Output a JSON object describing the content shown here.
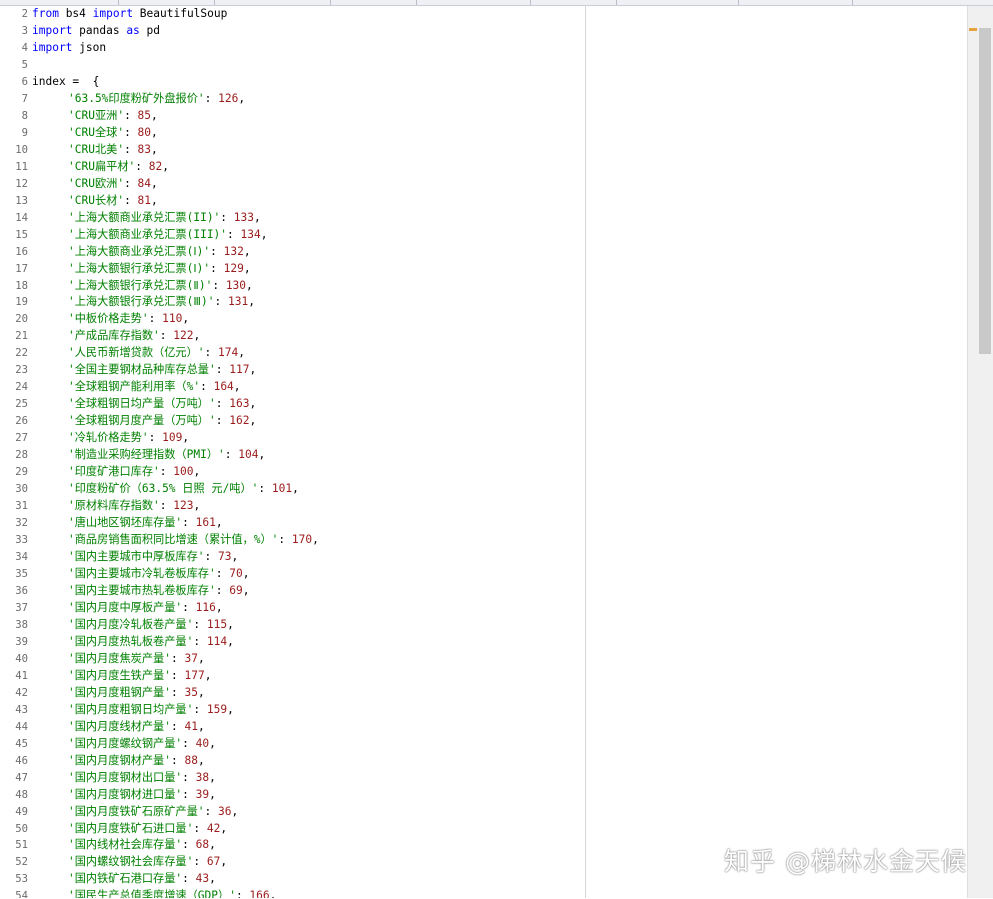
{
  "editor": {
    "lines": [
      {
        "n": "2",
        "segs": [
          {
            "c": "kw",
            "t": "from "
          },
          {
            "c": "pl",
            "t": "bs4 "
          },
          {
            "c": "kw",
            "t": "import "
          },
          {
            "c": "pl",
            "t": "BeautifulSoup"
          }
        ]
      },
      {
        "n": "3",
        "segs": [
          {
            "c": "kw",
            "t": "import "
          },
          {
            "c": "pl",
            "t": "pandas "
          },
          {
            "c": "kw",
            "t": "as "
          },
          {
            "c": "pl",
            "t": "pd"
          }
        ]
      },
      {
        "n": "4",
        "segs": [
          {
            "c": "kw",
            "t": "import "
          },
          {
            "c": "pl",
            "t": "json"
          }
        ]
      },
      {
        "n": "5",
        "segs": []
      },
      {
        "n": "6",
        "segs": [
          {
            "c": "pl",
            "t": "index =  {"
          }
        ]
      },
      {
        "n": "7",
        "ind": true,
        "segs": [
          {
            "c": "st",
            "t": "'63.5%印度粉矿外盘报价'"
          },
          {
            "c": "pl",
            "t": ": "
          },
          {
            "c": "nm",
            "t": "126"
          },
          {
            "c": "pl",
            "t": ","
          }
        ]
      },
      {
        "n": "8",
        "ind": true,
        "segs": [
          {
            "c": "st",
            "t": "'CRU亚洲'"
          },
          {
            "c": "pl",
            "t": ": "
          },
          {
            "c": "nm",
            "t": "85"
          },
          {
            "c": "pl",
            "t": ","
          }
        ]
      },
      {
        "n": "9",
        "ind": true,
        "segs": [
          {
            "c": "st",
            "t": "'CRU全球'"
          },
          {
            "c": "pl",
            "t": ": "
          },
          {
            "c": "nm",
            "t": "80"
          },
          {
            "c": "pl",
            "t": ","
          }
        ]
      },
      {
        "n": "10",
        "ind": true,
        "segs": [
          {
            "c": "st",
            "t": "'CRU北美'"
          },
          {
            "c": "pl",
            "t": ": "
          },
          {
            "c": "nm",
            "t": "83"
          },
          {
            "c": "pl",
            "t": ","
          }
        ]
      },
      {
        "n": "11",
        "ind": true,
        "segs": [
          {
            "c": "st",
            "t": "'CRU扁平材'"
          },
          {
            "c": "pl",
            "t": ": "
          },
          {
            "c": "nm",
            "t": "82"
          },
          {
            "c": "pl",
            "t": ","
          }
        ]
      },
      {
        "n": "12",
        "ind": true,
        "segs": [
          {
            "c": "st",
            "t": "'CRU欧洲'"
          },
          {
            "c": "pl",
            "t": ": "
          },
          {
            "c": "nm",
            "t": "84"
          },
          {
            "c": "pl",
            "t": ","
          }
        ]
      },
      {
        "n": "13",
        "ind": true,
        "segs": [
          {
            "c": "st",
            "t": "'CRU长材'"
          },
          {
            "c": "pl",
            "t": ": "
          },
          {
            "c": "nm",
            "t": "81"
          },
          {
            "c": "pl",
            "t": ","
          }
        ]
      },
      {
        "n": "14",
        "ind": true,
        "segs": [
          {
            "c": "st",
            "t": "'上海大额商业承兑汇票(II)'"
          },
          {
            "c": "pl",
            "t": ": "
          },
          {
            "c": "nm",
            "t": "133"
          },
          {
            "c": "pl",
            "t": ","
          }
        ]
      },
      {
        "n": "15",
        "ind": true,
        "segs": [
          {
            "c": "st",
            "t": "'上海大额商业承兑汇票(III)'"
          },
          {
            "c": "pl",
            "t": ": "
          },
          {
            "c": "nm",
            "t": "134"
          },
          {
            "c": "pl",
            "t": ","
          }
        ]
      },
      {
        "n": "16",
        "ind": true,
        "segs": [
          {
            "c": "st",
            "t": "'上海大额商业承兑汇票(Ⅰ)'"
          },
          {
            "c": "pl",
            "t": ": "
          },
          {
            "c": "nm",
            "t": "132"
          },
          {
            "c": "pl",
            "t": ","
          }
        ]
      },
      {
        "n": "17",
        "ind": true,
        "segs": [
          {
            "c": "st",
            "t": "'上海大额银行承兑汇票(Ⅰ)'"
          },
          {
            "c": "pl",
            "t": ": "
          },
          {
            "c": "nm",
            "t": "129"
          },
          {
            "c": "pl",
            "t": ","
          }
        ]
      },
      {
        "n": "18",
        "ind": true,
        "segs": [
          {
            "c": "st",
            "t": "'上海大额银行承兑汇票(Ⅱ)'"
          },
          {
            "c": "pl",
            "t": ": "
          },
          {
            "c": "nm",
            "t": "130"
          },
          {
            "c": "pl",
            "t": ","
          }
        ]
      },
      {
        "n": "19",
        "ind": true,
        "segs": [
          {
            "c": "st",
            "t": "'上海大额银行承兑汇票(Ⅲ)'"
          },
          {
            "c": "pl",
            "t": ": "
          },
          {
            "c": "nm",
            "t": "131"
          },
          {
            "c": "pl",
            "t": ","
          }
        ]
      },
      {
        "n": "20",
        "ind": true,
        "segs": [
          {
            "c": "st",
            "t": "'中板价格走势'"
          },
          {
            "c": "pl",
            "t": ": "
          },
          {
            "c": "nm",
            "t": "110"
          },
          {
            "c": "pl",
            "t": ","
          }
        ]
      },
      {
        "n": "21",
        "ind": true,
        "segs": [
          {
            "c": "st",
            "t": "'产成品库存指数'"
          },
          {
            "c": "pl",
            "t": ": "
          },
          {
            "c": "nm",
            "t": "122"
          },
          {
            "c": "pl",
            "t": ","
          }
        ]
      },
      {
        "n": "22",
        "ind": true,
        "segs": [
          {
            "c": "st",
            "t": "'人民币新增贷款（亿元）'"
          },
          {
            "c": "pl",
            "t": ": "
          },
          {
            "c": "nm",
            "t": "174"
          },
          {
            "c": "pl",
            "t": ","
          }
        ]
      },
      {
        "n": "23",
        "ind": true,
        "segs": [
          {
            "c": "st",
            "t": "'全国主要钢材品种库存总量'"
          },
          {
            "c": "pl",
            "t": ": "
          },
          {
            "c": "nm",
            "t": "117"
          },
          {
            "c": "pl",
            "t": ","
          }
        ]
      },
      {
        "n": "24",
        "ind": true,
        "segs": [
          {
            "c": "st",
            "t": "'全球粗钢产能利用率（%'"
          },
          {
            "c": "pl",
            "t": ": "
          },
          {
            "c": "nm",
            "t": "164"
          },
          {
            "c": "pl",
            "t": ","
          }
        ]
      },
      {
        "n": "25",
        "ind": true,
        "segs": [
          {
            "c": "st",
            "t": "'全球粗钢日均产量（万吨）'"
          },
          {
            "c": "pl",
            "t": ": "
          },
          {
            "c": "nm",
            "t": "163"
          },
          {
            "c": "pl",
            "t": ","
          }
        ]
      },
      {
        "n": "26",
        "ind": true,
        "segs": [
          {
            "c": "st",
            "t": "'全球粗钢月度产量（万吨）'"
          },
          {
            "c": "pl",
            "t": ": "
          },
          {
            "c": "nm",
            "t": "162"
          },
          {
            "c": "pl",
            "t": ","
          }
        ]
      },
      {
        "n": "27",
        "ind": true,
        "segs": [
          {
            "c": "st",
            "t": "'冷轧价格走势'"
          },
          {
            "c": "pl",
            "t": ": "
          },
          {
            "c": "nm",
            "t": "109"
          },
          {
            "c": "pl",
            "t": ","
          }
        ]
      },
      {
        "n": "28",
        "ind": true,
        "segs": [
          {
            "c": "st",
            "t": "'制造业采购经理指数（PMI）'"
          },
          {
            "c": "pl",
            "t": ": "
          },
          {
            "c": "nm",
            "t": "104"
          },
          {
            "c": "pl",
            "t": ","
          }
        ]
      },
      {
        "n": "29",
        "ind": true,
        "segs": [
          {
            "c": "st",
            "t": "'印度矿港口库存'"
          },
          {
            "c": "pl",
            "t": ": "
          },
          {
            "c": "nm",
            "t": "100"
          },
          {
            "c": "pl",
            "t": ","
          }
        ]
      },
      {
        "n": "30",
        "ind": true,
        "segs": [
          {
            "c": "st",
            "t": "'印度粉矿价（63.5% 日照 元/吨）'"
          },
          {
            "c": "pl",
            "t": ": "
          },
          {
            "c": "nm",
            "t": "101"
          },
          {
            "c": "pl",
            "t": ","
          }
        ]
      },
      {
        "n": "31",
        "ind": true,
        "segs": [
          {
            "c": "st",
            "t": "'原材料库存指数'"
          },
          {
            "c": "pl",
            "t": ": "
          },
          {
            "c": "nm",
            "t": "123"
          },
          {
            "c": "pl",
            "t": ","
          }
        ]
      },
      {
        "n": "32",
        "ind": true,
        "segs": [
          {
            "c": "st",
            "t": "'唐山地区钢坯库存量'"
          },
          {
            "c": "pl",
            "t": ": "
          },
          {
            "c": "nm",
            "t": "161"
          },
          {
            "c": "pl",
            "t": ","
          }
        ]
      },
      {
        "n": "33",
        "ind": true,
        "segs": [
          {
            "c": "st",
            "t": "'商品房销售面积同比增速（累计值，%）'"
          },
          {
            "c": "pl",
            "t": ": "
          },
          {
            "c": "nm",
            "t": "170"
          },
          {
            "c": "pl",
            "t": ","
          }
        ]
      },
      {
        "n": "34",
        "ind": true,
        "segs": [
          {
            "c": "st",
            "t": "'国内主要城市中厚板库存'"
          },
          {
            "c": "pl",
            "t": ": "
          },
          {
            "c": "nm",
            "t": "73"
          },
          {
            "c": "pl",
            "t": ","
          }
        ]
      },
      {
        "n": "35",
        "ind": true,
        "segs": [
          {
            "c": "st",
            "t": "'国内主要城市冷轧卷板库存'"
          },
          {
            "c": "pl",
            "t": ": "
          },
          {
            "c": "nm",
            "t": "70"
          },
          {
            "c": "pl",
            "t": ","
          }
        ]
      },
      {
        "n": "36",
        "ind": true,
        "segs": [
          {
            "c": "st",
            "t": "'国内主要城市热轧卷板库存'"
          },
          {
            "c": "pl",
            "t": ": "
          },
          {
            "c": "nm",
            "t": "69"
          },
          {
            "c": "pl",
            "t": ","
          }
        ]
      },
      {
        "n": "37",
        "ind": true,
        "segs": [
          {
            "c": "st",
            "t": "'国内月度中厚板产量'"
          },
          {
            "c": "pl",
            "t": ": "
          },
          {
            "c": "nm",
            "t": "116"
          },
          {
            "c": "pl",
            "t": ","
          }
        ]
      },
      {
        "n": "38",
        "ind": true,
        "segs": [
          {
            "c": "st",
            "t": "'国内月度冷轧板卷产量'"
          },
          {
            "c": "pl",
            "t": ": "
          },
          {
            "c": "nm",
            "t": "115"
          },
          {
            "c": "pl",
            "t": ","
          }
        ]
      },
      {
        "n": "39",
        "ind": true,
        "segs": [
          {
            "c": "st",
            "t": "'国内月度热轧板卷产量'"
          },
          {
            "c": "pl",
            "t": ": "
          },
          {
            "c": "nm",
            "t": "114"
          },
          {
            "c": "pl",
            "t": ","
          }
        ]
      },
      {
        "n": "40",
        "ind": true,
        "segs": [
          {
            "c": "st",
            "t": "'国内月度焦炭产量'"
          },
          {
            "c": "pl",
            "t": ": "
          },
          {
            "c": "nm",
            "t": "37"
          },
          {
            "c": "pl",
            "t": ","
          }
        ]
      },
      {
        "n": "41",
        "ind": true,
        "segs": [
          {
            "c": "st",
            "t": "'国内月度生铁产量'"
          },
          {
            "c": "pl",
            "t": ": "
          },
          {
            "c": "nm",
            "t": "177"
          },
          {
            "c": "pl",
            "t": ","
          }
        ]
      },
      {
        "n": "42",
        "ind": true,
        "segs": [
          {
            "c": "st",
            "t": "'国内月度粗钢产量'"
          },
          {
            "c": "pl",
            "t": ": "
          },
          {
            "c": "nm",
            "t": "35"
          },
          {
            "c": "pl",
            "t": ","
          }
        ]
      },
      {
        "n": "43",
        "ind": true,
        "segs": [
          {
            "c": "st",
            "t": "'国内月度粗钢日均产量'"
          },
          {
            "c": "pl",
            "t": ": "
          },
          {
            "c": "nm",
            "t": "159"
          },
          {
            "c": "pl",
            "t": ","
          }
        ]
      },
      {
        "n": "44",
        "ind": true,
        "segs": [
          {
            "c": "st",
            "t": "'国内月度线材产量'"
          },
          {
            "c": "pl",
            "t": ": "
          },
          {
            "c": "nm",
            "t": "41"
          },
          {
            "c": "pl",
            "t": ","
          }
        ]
      },
      {
        "n": "45",
        "ind": true,
        "segs": [
          {
            "c": "st",
            "t": "'国内月度螺纹钢产量'"
          },
          {
            "c": "pl",
            "t": ": "
          },
          {
            "c": "nm",
            "t": "40"
          },
          {
            "c": "pl",
            "t": ","
          }
        ]
      },
      {
        "n": "46",
        "ind": true,
        "segs": [
          {
            "c": "st",
            "t": "'国内月度钢材产量'"
          },
          {
            "c": "pl",
            "t": ": "
          },
          {
            "c": "nm",
            "t": "88"
          },
          {
            "c": "pl",
            "t": ","
          }
        ]
      },
      {
        "n": "47",
        "ind": true,
        "segs": [
          {
            "c": "st",
            "t": "'国内月度钢材出口量'"
          },
          {
            "c": "pl",
            "t": ": "
          },
          {
            "c": "nm",
            "t": "38"
          },
          {
            "c": "pl",
            "t": ","
          }
        ]
      },
      {
        "n": "48",
        "ind": true,
        "segs": [
          {
            "c": "st",
            "t": "'国内月度钢材进口量'"
          },
          {
            "c": "pl",
            "t": ": "
          },
          {
            "c": "nm",
            "t": "39"
          },
          {
            "c": "pl",
            "t": ","
          }
        ]
      },
      {
        "n": "49",
        "ind": true,
        "segs": [
          {
            "c": "st",
            "t": "'国内月度铁矿石原矿产量'"
          },
          {
            "c": "pl",
            "t": ": "
          },
          {
            "c": "nm",
            "t": "36"
          },
          {
            "c": "pl",
            "t": ","
          }
        ]
      },
      {
        "n": "50",
        "ind": true,
        "segs": [
          {
            "c": "st",
            "t": "'国内月度铁矿石进口量'"
          },
          {
            "c": "pl",
            "t": ": "
          },
          {
            "c": "nm",
            "t": "42"
          },
          {
            "c": "pl",
            "t": ","
          }
        ]
      },
      {
        "n": "51",
        "ind": true,
        "segs": [
          {
            "c": "st",
            "t": "'国内线材社会库存量'"
          },
          {
            "c": "pl",
            "t": ": "
          },
          {
            "c": "nm",
            "t": "68"
          },
          {
            "c": "pl",
            "t": ","
          }
        ]
      },
      {
        "n": "52",
        "ind": true,
        "segs": [
          {
            "c": "st",
            "t": "'国内螺纹钢社会库存量'"
          },
          {
            "c": "pl",
            "t": ": "
          },
          {
            "c": "nm",
            "t": "67"
          },
          {
            "c": "pl",
            "t": ","
          }
        ]
      },
      {
        "n": "53",
        "ind": true,
        "segs": [
          {
            "c": "st",
            "t": "'国内铁矿石港口存量'"
          },
          {
            "c": "pl",
            "t": ": "
          },
          {
            "c": "nm",
            "t": "43"
          },
          {
            "c": "pl",
            "t": ","
          }
        ]
      },
      {
        "n": "54",
        "ind": true,
        "segs": [
          {
            "c": "st",
            "t": "'国民生产总值季度增速（GDP）'"
          },
          {
            "c": "pl",
            "t": ": "
          },
          {
            "c": "nm",
            "t": "166"
          },
          {
            "c": "pl",
            "t": ","
          }
        ]
      }
    ]
  },
  "watermark": "知乎 @梯林水金天候",
  "colors": {
    "keyword": "#0000ff",
    "string": "#008000",
    "number": "#9b1b1b",
    "plain": "#000000",
    "line_number": "#6c6c6c",
    "scroll_marker": "#e6a23c"
  }
}
